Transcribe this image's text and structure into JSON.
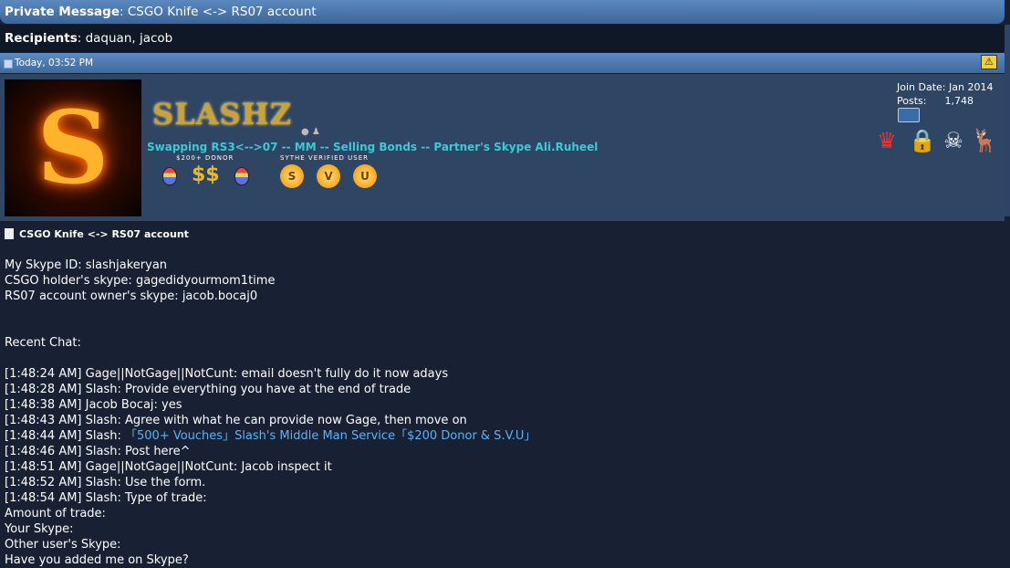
{
  "title_bar": {
    "label": "Private Message",
    "subject": "CSGO Knife <-> RS07 account"
  },
  "recipients": {
    "label": "Recipients",
    "value": "daquan, jacob"
  },
  "post": {
    "date": "Today, 03:52 PM",
    "warn_icon": "warning-triangle-icon",
    "title": "CSGO Knife <-> RS07 account"
  },
  "user": {
    "avatar_letter": "S",
    "name_logo": "SLASHZ",
    "usertitle": "Swapping RS3<-->07 -- MM -- Selling Bonds -- Partner's Skype Ali.Ruheel",
    "badge_donor_label": "$200+ DONOR",
    "badge_svu_label": "SYTHE VERIFIED USER",
    "svu_letters": [
      "S",
      "V",
      "U"
    ],
    "join_date_label": "Join Date:",
    "join_date": "Jan 2014",
    "posts_label": "Posts:",
    "posts": "1,748"
  },
  "message_lines": [
    "My Skype ID: slashjakeryan",
    "CSGO holder's skype: gagedidyourmom1time",
    "RS07 account owner's skype: jacob.bocaj0",
    "Recent Chat:",
    "[1:48:24 AM] Gage||NotGage||NotCunt: email doesn't fully do it now adays",
    "[1:48:28 AM] Slash: Provide everything you have at the end of trade",
    "[1:48:38 AM] Jacob Bocaj: yes",
    "[1:48:43 AM] Slash: Agree with what he can provide now Gage, then move on",
    "[1:48:44 AM] Slash: ",
    "[1:48:46 AM] Slash: Post here^",
    "[1:48:51 AM] Gage||NotGage||NotCunt: Jacob inspect it",
    "[1:48:52 AM] Slash: Use the form.",
    "[1:48:54 AM] Slash: Type of trade:",
    "Amount of trade:",
    "Your Skype:",
    "Other user's Skype:",
    "Have you added me on Skype?"
  ],
  "thread_link": "「500+ Vouches」Slash's Middle Man Service「$200 Donor & S.V.U」"
}
